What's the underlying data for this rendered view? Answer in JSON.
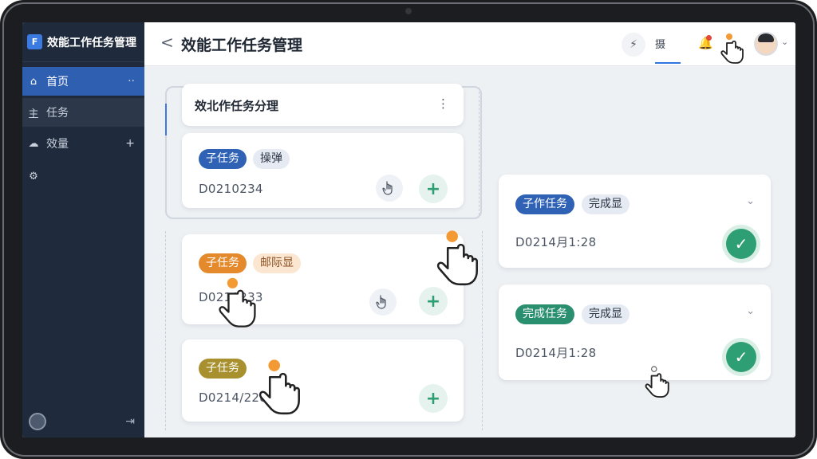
{
  "app": {
    "title": "效能工作任务管理"
  },
  "sidebar": {
    "items": [
      {
        "label": "首页",
        "icon": "home-icon",
        "glyph": "⌂",
        "trail": "··"
      },
      {
        "label": "任务",
        "icon": "task-icon",
        "glyph": "主",
        "trail": ""
      },
      {
        "label": "效量",
        "icon": "chart-icon",
        "glyph": "☁",
        "trail": "+"
      },
      {
        "label": "",
        "icon": "gear-icon",
        "glyph": "⚙",
        "trail": ""
      }
    ],
    "footer": {
      "logout_glyph": "⇥"
    }
  },
  "header": {
    "page_title": "效能工作任务管理",
    "back_glyph": "<",
    "quick_button_glyph": "⚡",
    "tab_label": "摄",
    "bell_glyph": "🔔",
    "caret_glyph": "⌄"
  },
  "group": {
    "title": "效北作任务分理",
    "menu_glyph": "⋮"
  },
  "left_cards": [
    {
      "tags": [
        {
          "text": "子任务",
          "bg": "#2f62b5",
          "fg": "#ffffff"
        },
        {
          "text": "操弹",
          "bg": "#e6ebf3",
          "fg": "#2d3544"
        }
      ],
      "code": "D0210234"
    },
    {
      "tags": [
        {
          "text": "子任务",
          "bg": "#e58a2c",
          "fg": "#ffffff"
        },
        {
          "text": "邮际显",
          "bg": "#fbe6d2",
          "fg": "#8a5120"
        }
      ],
      "code": "D0210233"
    },
    {
      "tags": [
        {
          "text": "子任务",
          "bg": "#a9902f",
          "fg": "#ffffff"
        }
      ],
      "code": "D0214/228"
    }
  ],
  "right_cards": [
    {
      "tags": [
        {
          "text": "子作任务",
          "bg": "#2f62b5",
          "fg": "#ffffff"
        },
        {
          "text": "完成显",
          "bg": "#e6ebf3",
          "fg": "#2d3544"
        }
      ],
      "time": "D0214月1:28"
    },
    {
      "tags": [
        {
          "text": "完成任务",
          "bg": "#2a8f6e",
          "fg": "#ffffff"
        },
        {
          "text": "完成显",
          "bg": "#e6ebf3",
          "fg": "#2d3544"
        }
      ],
      "time": "D0214月1:28"
    }
  ],
  "glyphs": {
    "plus": "+",
    "check": "✓",
    "caret": "⌄",
    "grab": "☝"
  },
  "colors": {
    "accent": "#2f74e0",
    "sidebar_bg": "#1f2a3c",
    "success": "#2e9e74",
    "cursor_spark": "#f39a35"
  }
}
